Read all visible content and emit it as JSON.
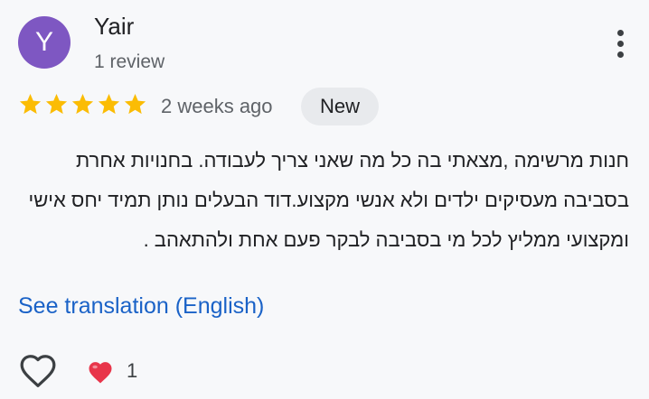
{
  "author": {
    "initial": "Y",
    "name": "Yair",
    "review_count": "1 review",
    "avatar_color": "#7e57c2"
  },
  "menu": {
    "icon": "more-vert-icon"
  },
  "rating": {
    "stars": 5,
    "max": 5,
    "star_color": "#fbbc04"
  },
  "time_ago": "2 weeks ago",
  "badge": "New",
  "review_text": "חנות מרשימה ,מצאתי בה כל מה שאני צריך לעבודה. בחנויות אחרת בסביבה מעסיקים ילדים ולא אנשי מקצוע.דוד הבעלים נותן תמיד יחס אישי ומקצועי ממליץ לכל מי בסביבה לבקר פעם אחת ולהתאהב .",
  "translation_link": "See translation (English)",
  "reactions": {
    "like_icon": "heart-outline-icon",
    "reaction_icon": "heart-icon",
    "count": "1",
    "reaction_color": "#e8354a"
  }
}
